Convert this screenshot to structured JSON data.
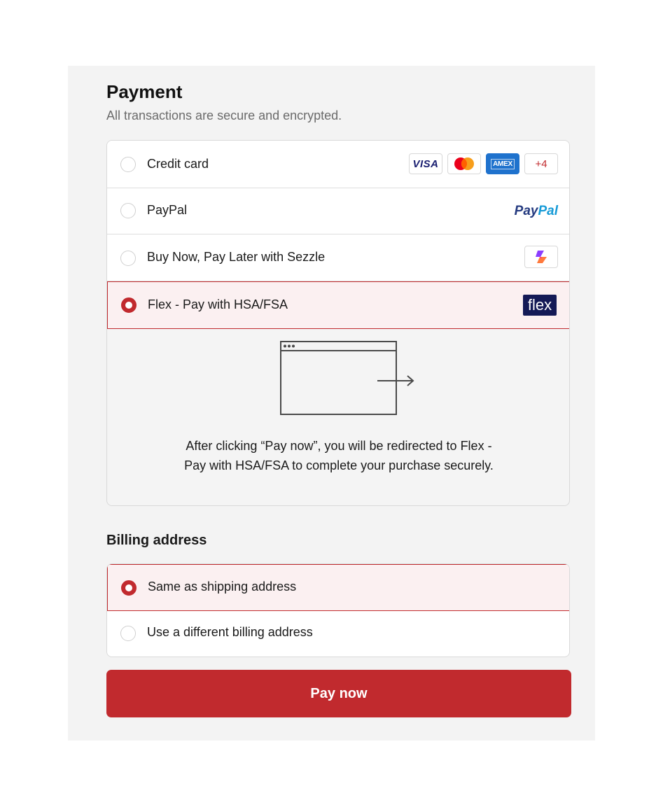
{
  "payment": {
    "title": "Payment",
    "subtitle": "All transactions are secure and encrypted.",
    "methods": [
      {
        "label": "Credit card",
        "selected": false,
        "icons": [
          "visa-icon",
          "mastercard-icon",
          "amex-icon"
        ]
      },
      {
        "label": "PayPal",
        "selected": false,
        "icons": [
          "paypal-logo"
        ]
      },
      {
        "label": "Buy Now, Pay Later with Sezzle",
        "selected": false,
        "icons": [
          "sezzle-icon"
        ]
      },
      {
        "label": "Flex - Pay with HSA/FSA",
        "selected": true,
        "icons": [
          "flex-logo"
        ]
      }
    ],
    "card_brands": {
      "visa": "VISA",
      "amex": "AMEX",
      "more": "+4"
    },
    "paypal_logo": {
      "part1": "Pay",
      "part2": "Pal"
    },
    "flex_logo": "flex",
    "redirect_message": "After clicking “Pay now”, you will be redirected to Flex - Pay with HSA/FSA to complete your purchase securely."
  },
  "billing": {
    "title": "Billing address",
    "options": [
      {
        "label": "Same as shipping address",
        "selected": true
      },
      {
        "label": "Use a different billing address",
        "selected": false
      }
    ]
  },
  "pay_button": {
    "label": "Pay now"
  },
  "colors": {
    "accent": "#c12a2e",
    "selected_bg": "#fbf0f1",
    "panel_bg": "#f3f3f3",
    "flex_brand": "#141a56"
  }
}
